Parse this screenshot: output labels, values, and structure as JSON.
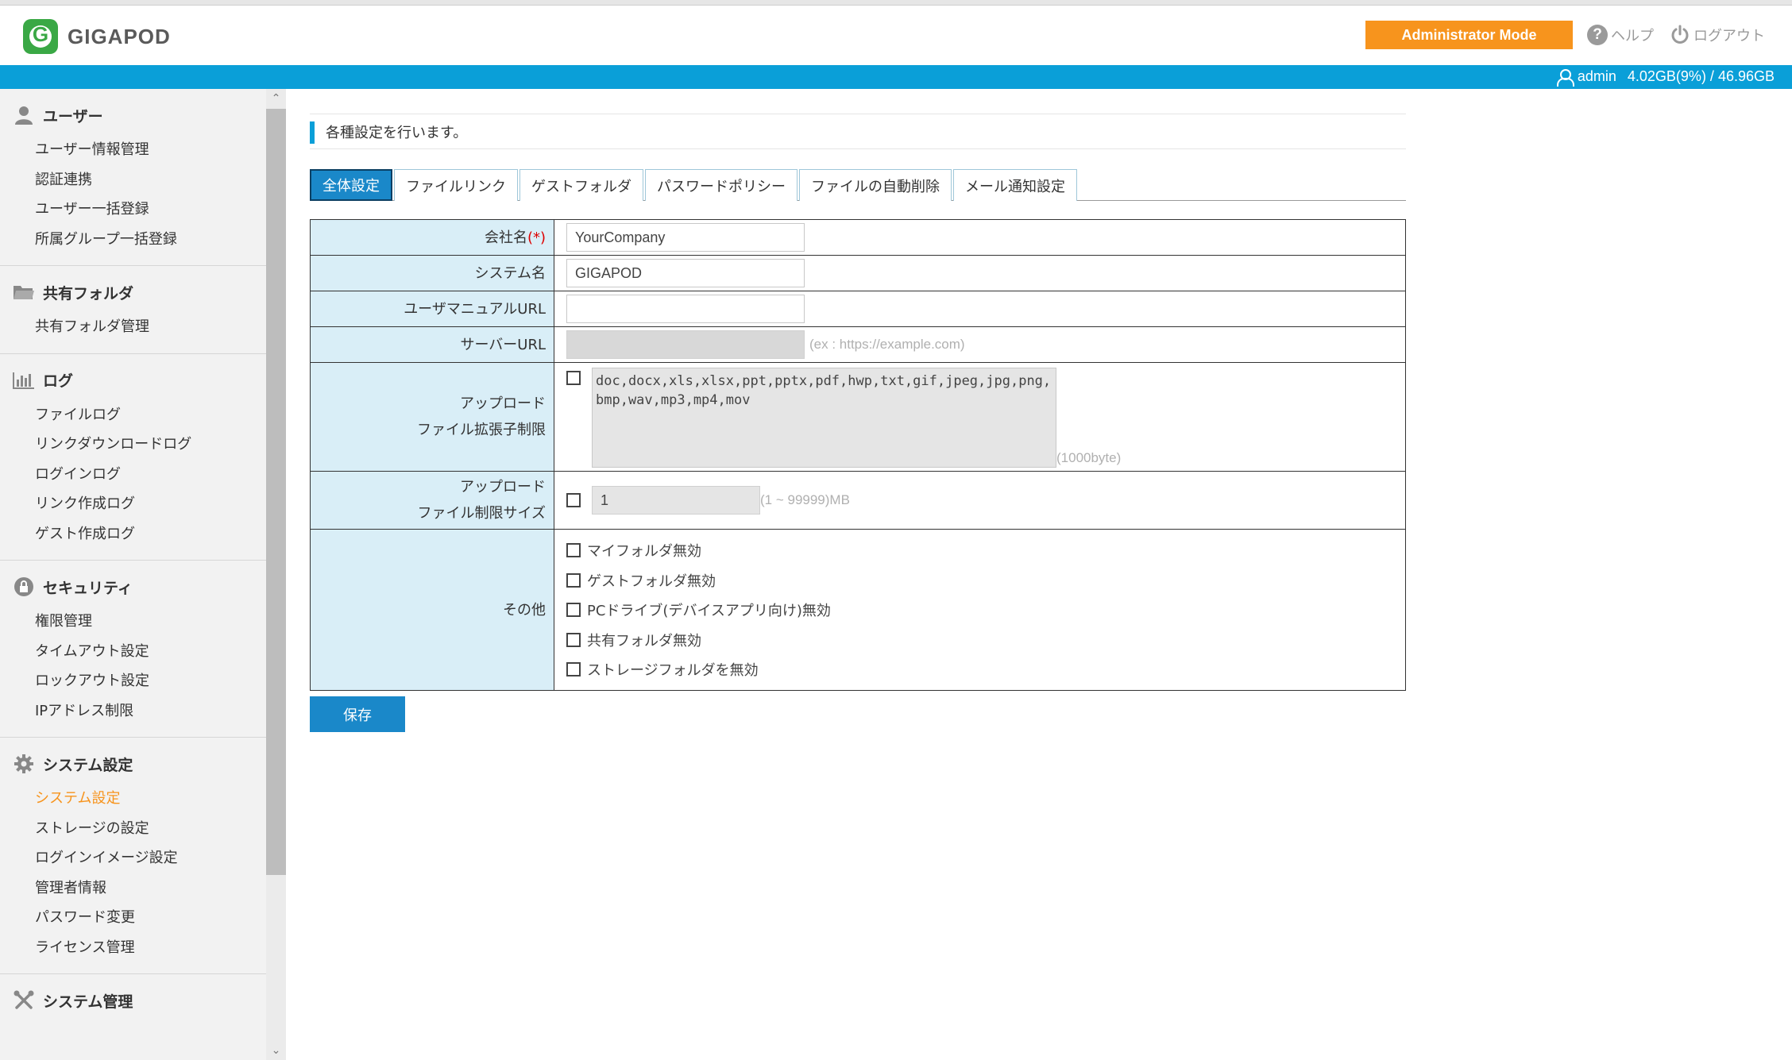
{
  "header": {
    "logo_text": "GIGAPOD",
    "admin_mode": "Administrator Mode",
    "help": "ヘルプ",
    "logout": "ログアウト"
  },
  "status": {
    "user": "admin",
    "storage": "4.02GB(9%) / 46.96GB"
  },
  "sidebar": {
    "sections": [
      {
        "title": "ユーザー",
        "icon": "user-icon",
        "items": [
          "ユーザー情報管理",
          "認証連携",
          "ユーザー一括登録",
          "所属グループ一括登録"
        ]
      },
      {
        "title": "共有フォルダ",
        "icon": "folder-icon",
        "items": [
          "共有フォルダ管理"
        ]
      },
      {
        "title": "ログ",
        "icon": "bar-chart-icon",
        "items": [
          "ファイルログ",
          "リンクダウンロードログ",
          "ログインログ",
          "リンク作成ログ",
          "ゲスト作成ログ"
        ]
      },
      {
        "title": "セキュリティ",
        "icon": "lock-icon",
        "items": [
          "権限管理",
          "タイムアウト設定",
          "ロックアウト設定",
          "IPアドレス制限"
        ]
      },
      {
        "title": "システム設定",
        "icon": "gear-icon",
        "items": [
          "システム設定",
          "ストレージの設定",
          "ログインイメージ設定",
          "管理者情報",
          "パスワード変更",
          "ライセンス管理"
        ],
        "active_item": 0
      },
      {
        "title": "システム管理",
        "icon": "tools-icon",
        "items": []
      }
    ]
  },
  "main": {
    "notice": "各種設定を行います。",
    "tabs": [
      "全体設定",
      "ファイルリンク",
      "ゲストフォルダ",
      "パスワードポリシー",
      "ファイルの自動削除",
      "メール通知設定"
    ],
    "active_tab": 0,
    "form": {
      "company": {
        "label": "会社名",
        "required_mark": "(*)",
        "value": "YourCompany"
      },
      "system_name": {
        "label": "システム名",
        "value": "GIGAPOD"
      },
      "manual_url": {
        "label": "ユーザマニュアルURL",
        "value": ""
      },
      "server_url": {
        "label": "サーバーURL",
        "value": "",
        "hint": "(ex : https://example.com)"
      },
      "upload_ext": {
        "label_1": "アップロード",
        "label_2": "ファイル拡張子制限",
        "value": "doc,docx,xls,xlsx,ppt,pptx,pdf,hwp,txt,gif,jpeg,jpg,png,bmp,wav,mp3,mp4,mov",
        "hint": "(1000byte)",
        "checked": false
      },
      "upload_size": {
        "label_1": "アップロード",
        "label_2": "ファイル制限サイズ",
        "value": "1",
        "hint": "(1 ~ 99999)MB",
        "checked": false
      },
      "other": {
        "label": "その他",
        "options": [
          "マイフォルダ無効",
          "ゲストフォルダ無効",
          "PCドライブ(デバイスアプリ向け)無効",
          "共有フォルダ無効",
          "ストレージフォルダを無効"
        ]
      }
    },
    "save_label": "保存"
  }
}
